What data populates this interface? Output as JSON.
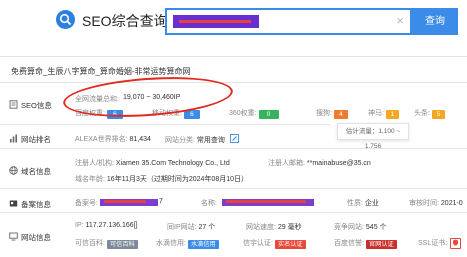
{
  "header": {
    "site_name": "SEO综合查询",
    "search_button": "查询",
    "clear_symbol": "×"
  },
  "page_title": "免费算命_生辰八字算命_算命婚姻-非常运势算命网",
  "seo": {
    "label": "SEO信息",
    "traffic_label": "全网流量总和:",
    "traffic_value": "19,070 ~ 30,460IP",
    "baidu_label": "百度权重:",
    "baidu_value": "6",
    "mobile_label": "移动权重:",
    "mobile_value": "6",
    "w360_label": "360权重:",
    "w360_value": "0",
    "sogou_label": "搜狗:",
    "sogou_value": "4",
    "shenma_label": "神马:",
    "shenma_value": "1",
    "toutiao_label": "头条:",
    "toutiao_value": "5",
    "tooltip": "估计流量：1,100 ~ 1,756"
  },
  "rank": {
    "label": "网站排名",
    "alexa_label": "ALEXA世界排名:",
    "alexa_value": "81,434",
    "category_label": "网站分类:",
    "category_value": "常用查询"
  },
  "domain": {
    "label": "域名信息",
    "registrant_label": "注册人/机构:",
    "registrant_value": "Xiamen 35.Com Technology Co., Ltd",
    "email_label": "注册人邮箱:",
    "email_value": "**mainabuse@35.cn",
    "age_label": "域名年龄:",
    "age_value": "16年11月3天（过期时间为2024年08月10日）"
  },
  "icp": {
    "label": "备案信息",
    "number_label": "备案号:",
    "number_tail": "7",
    "name_label": "名称:",
    "nature_label": "性质:",
    "nature_value": "企业",
    "time_label": "审核时间:",
    "time_value": "2021-0"
  },
  "site": {
    "label": "网站信息",
    "ip_label": "IP:",
    "ip_value": "117.27.136.166[]",
    "same_ip_label": "同IP网站:",
    "same_ip_value": "27 个",
    "speed_label": "网站速度:",
    "speed_value": "29 毫秒",
    "compete_label": "竞争网站:",
    "compete_value": "545 个",
    "baike_label": "可信百科:",
    "baike_tag": "可信百科",
    "shuiying_label": "水滴信用:",
    "shuiying_tag": "水滴信用",
    "credit_label": "信宇认证:",
    "credit_tag": "实名认证",
    "nano_label": "百度信誉:",
    "nano_tag": "官网认证",
    "ssl_label": "SSL证书:"
  },
  "colors": {
    "accent": "#3b8ce8",
    "annotation_oval": "#e02b20"
  }
}
